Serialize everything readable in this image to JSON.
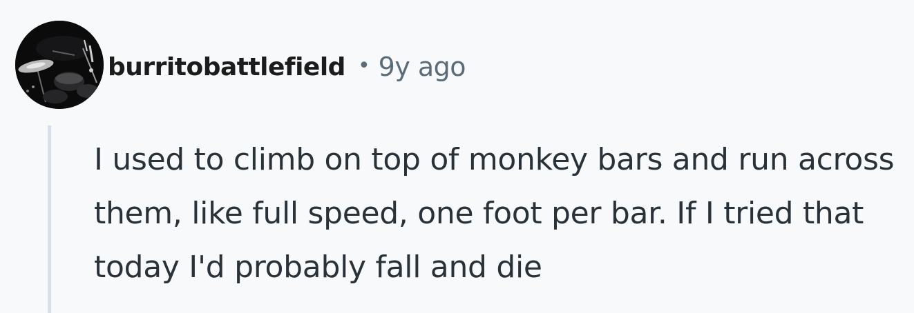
{
  "comment": {
    "author": "burritobattlefield",
    "separator": "•",
    "timestamp": "9y ago",
    "body": "I used to climb on top of monkey bars and run across them, like full speed, one foot per bar. If I tried that today I'd probably fall and die",
    "avatar": {
      "icon": "user-avatar-drum-kit-photo",
      "background_color": "#0b0b0c"
    }
  },
  "colors": {
    "page_background": "#f7f9fb",
    "author_text": "#1c1c1c",
    "meta_text": "#5b6b78",
    "body_text": "#2a3239",
    "thread_line": "#d7dfe8"
  }
}
